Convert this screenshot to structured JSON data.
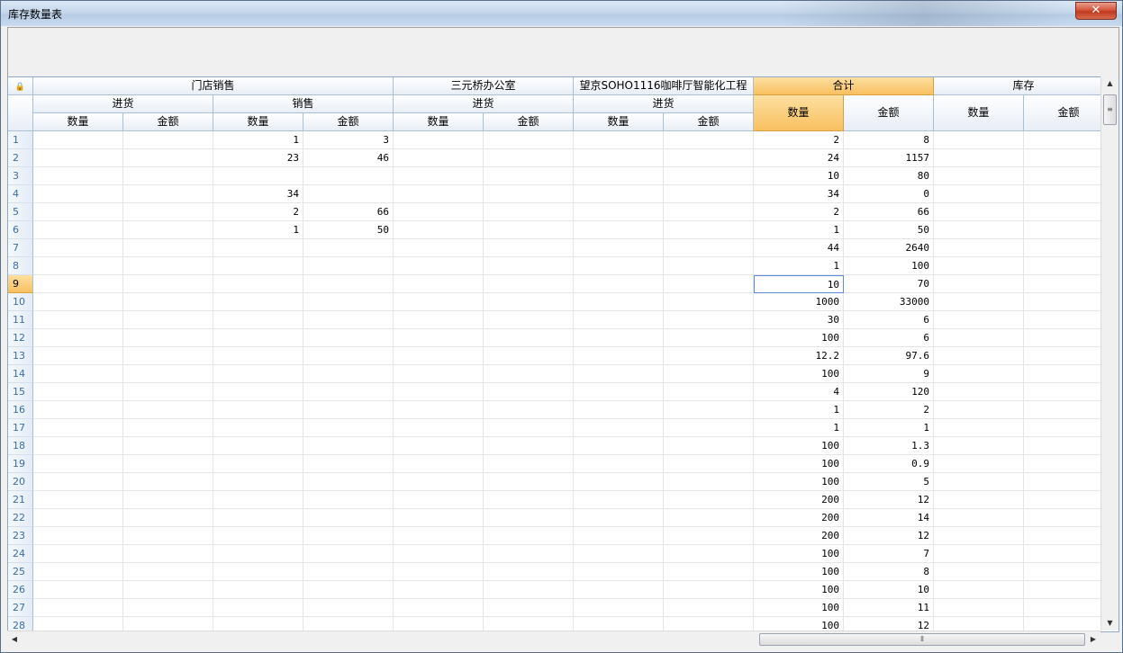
{
  "window": {
    "title": "库存数量表",
    "close_glyph": "✕"
  },
  "grid": {
    "corner_icon": "lock-icon",
    "groups": [
      "门店销售",
      "三元桥办公室",
      "望京SOHO1116咖啡厅智能化工程",
      "合计",
      "库存"
    ],
    "subgroups": [
      "进货",
      "销售",
      "进货",
      "进货"
    ],
    "col_labels": [
      "数量",
      "金额",
      "数量",
      "金额",
      "数量",
      "金额",
      "数量",
      "金额",
      "数量",
      "金额",
      "数量",
      "金额"
    ],
    "selected_row": 9,
    "focused_cell": {
      "row": 9,
      "col": 8
    },
    "rows": [
      [
        "1",
        "",
        "",
        "1",
        "3",
        "",
        "",
        "",
        "",
        "2",
        "8",
        "",
        ""
      ],
      [
        "2",
        "",
        "",
        "23",
        "46",
        "",
        "",
        "",
        "",
        "24",
        "1157",
        "",
        ""
      ],
      [
        "3",
        "",
        "",
        "",
        "",
        "",
        "",
        "",
        "",
        "10",
        "80",
        "",
        ""
      ],
      [
        "4",
        "",
        "",
        "34",
        "",
        "",
        "",
        "",
        "",
        "34",
        "0",
        "",
        ""
      ],
      [
        "5",
        "",
        "",
        "2",
        "66",
        "",
        "",
        "",
        "",
        "2",
        "66",
        "",
        ""
      ],
      [
        "6",
        "",
        "",
        "1",
        "50",
        "",
        "",
        "",
        "",
        "1",
        "50",
        "",
        ""
      ],
      [
        "7",
        "",
        "",
        "",
        "",
        "",
        "",
        "",
        "",
        "44",
        "2640",
        "",
        ""
      ],
      [
        "8",
        "",
        "",
        "",
        "",
        "",
        "",
        "",
        "",
        "1",
        "100",
        "",
        ""
      ],
      [
        "9",
        "",
        "",
        "",
        "",
        "",
        "",
        "",
        "",
        "10",
        "70",
        "",
        ""
      ],
      [
        "10",
        "",
        "",
        "",
        "",
        "",
        "",
        "",
        "",
        "1000",
        "33000",
        "",
        ""
      ],
      [
        "11",
        "",
        "",
        "",
        "",
        "",
        "",
        "",
        "",
        "30",
        "6",
        "",
        ""
      ],
      [
        "12",
        "",
        "",
        "",
        "",
        "",
        "",
        "",
        "",
        "100",
        "6",
        "",
        ""
      ],
      [
        "13",
        "",
        "",
        "",
        "",
        "",
        "",
        "",
        "",
        "12.2",
        "97.6",
        "",
        ""
      ],
      [
        "14",
        "",
        "",
        "",
        "",
        "",
        "",
        "",
        "",
        "100",
        "9",
        "",
        ""
      ],
      [
        "15",
        "",
        "",
        "",
        "",
        "",
        "",
        "",
        "",
        "4",
        "120",
        "",
        ""
      ],
      [
        "16",
        "",
        "",
        "",
        "",
        "",
        "",
        "",
        "",
        "1",
        "2",
        "",
        ""
      ],
      [
        "17",
        "",
        "",
        "",
        "",
        "",
        "",
        "",
        "",
        "1",
        "1",
        "",
        ""
      ],
      [
        "18",
        "",
        "",
        "",
        "",
        "",
        "",
        "",
        "",
        "100",
        "1.3",
        "",
        ""
      ],
      [
        "19",
        "",
        "",
        "",
        "",
        "",
        "",
        "",
        "",
        "100",
        "0.9",
        "",
        ""
      ],
      [
        "20",
        "",
        "",
        "",
        "",
        "",
        "",
        "",
        "",
        "100",
        "5",
        "",
        ""
      ],
      [
        "21",
        "",
        "",
        "",
        "",
        "",
        "",
        "",
        "",
        "200",
        "12",
        "",
        ""
      ],
      [
        "22",
        "",
        "",
        "",
        "",
        "",
        "",
        "",
        "",
        "200",
        "14",
        "",
        ""
      ],
      [
        "23",
        "",
        "",
        "",
        "",
        "",
        "",
        "",
        "",
        "200",
        "12",
        "",
        ""
      ],
      [
        "24",
        "",
        "",
        "",
        "",
        "",
        "",
        "",
        "",
        "100",
        "7",
        "",
        ""
      ],
      [
        "25",
        "",
        "",
        "",
        "",
        "",
        "",
        "",
        "",
        "100",
        "8",
        "",
        ""
      ],
      [
        "26",
        "",
        "",
        "",
        "",
        "",
        "",
        "",
        "",
        "100",
        "10",
        "",
        ""
      ],
      [
        "27",
        "",
        "",
        "",
        "",
        "",
        "",
        "",
        "",
        "100",
        "11",
        "",
        ""
      ],
      [
        "28",
        "",
        "",
        "",
        "",
        "",
        "",
        "",
        "",
        "100",
        "12",
        "",
        ""
      ]
    ]
  },
  "scrollbars": {
    "up_glyph": "▲",
    "down_glyph": "▼",
    "left_glyph": "◀",
    "right_glyph": "▶",
    "grip_glyph": "≡",
    "hgrip_glyph": "⦀"
  }
}
